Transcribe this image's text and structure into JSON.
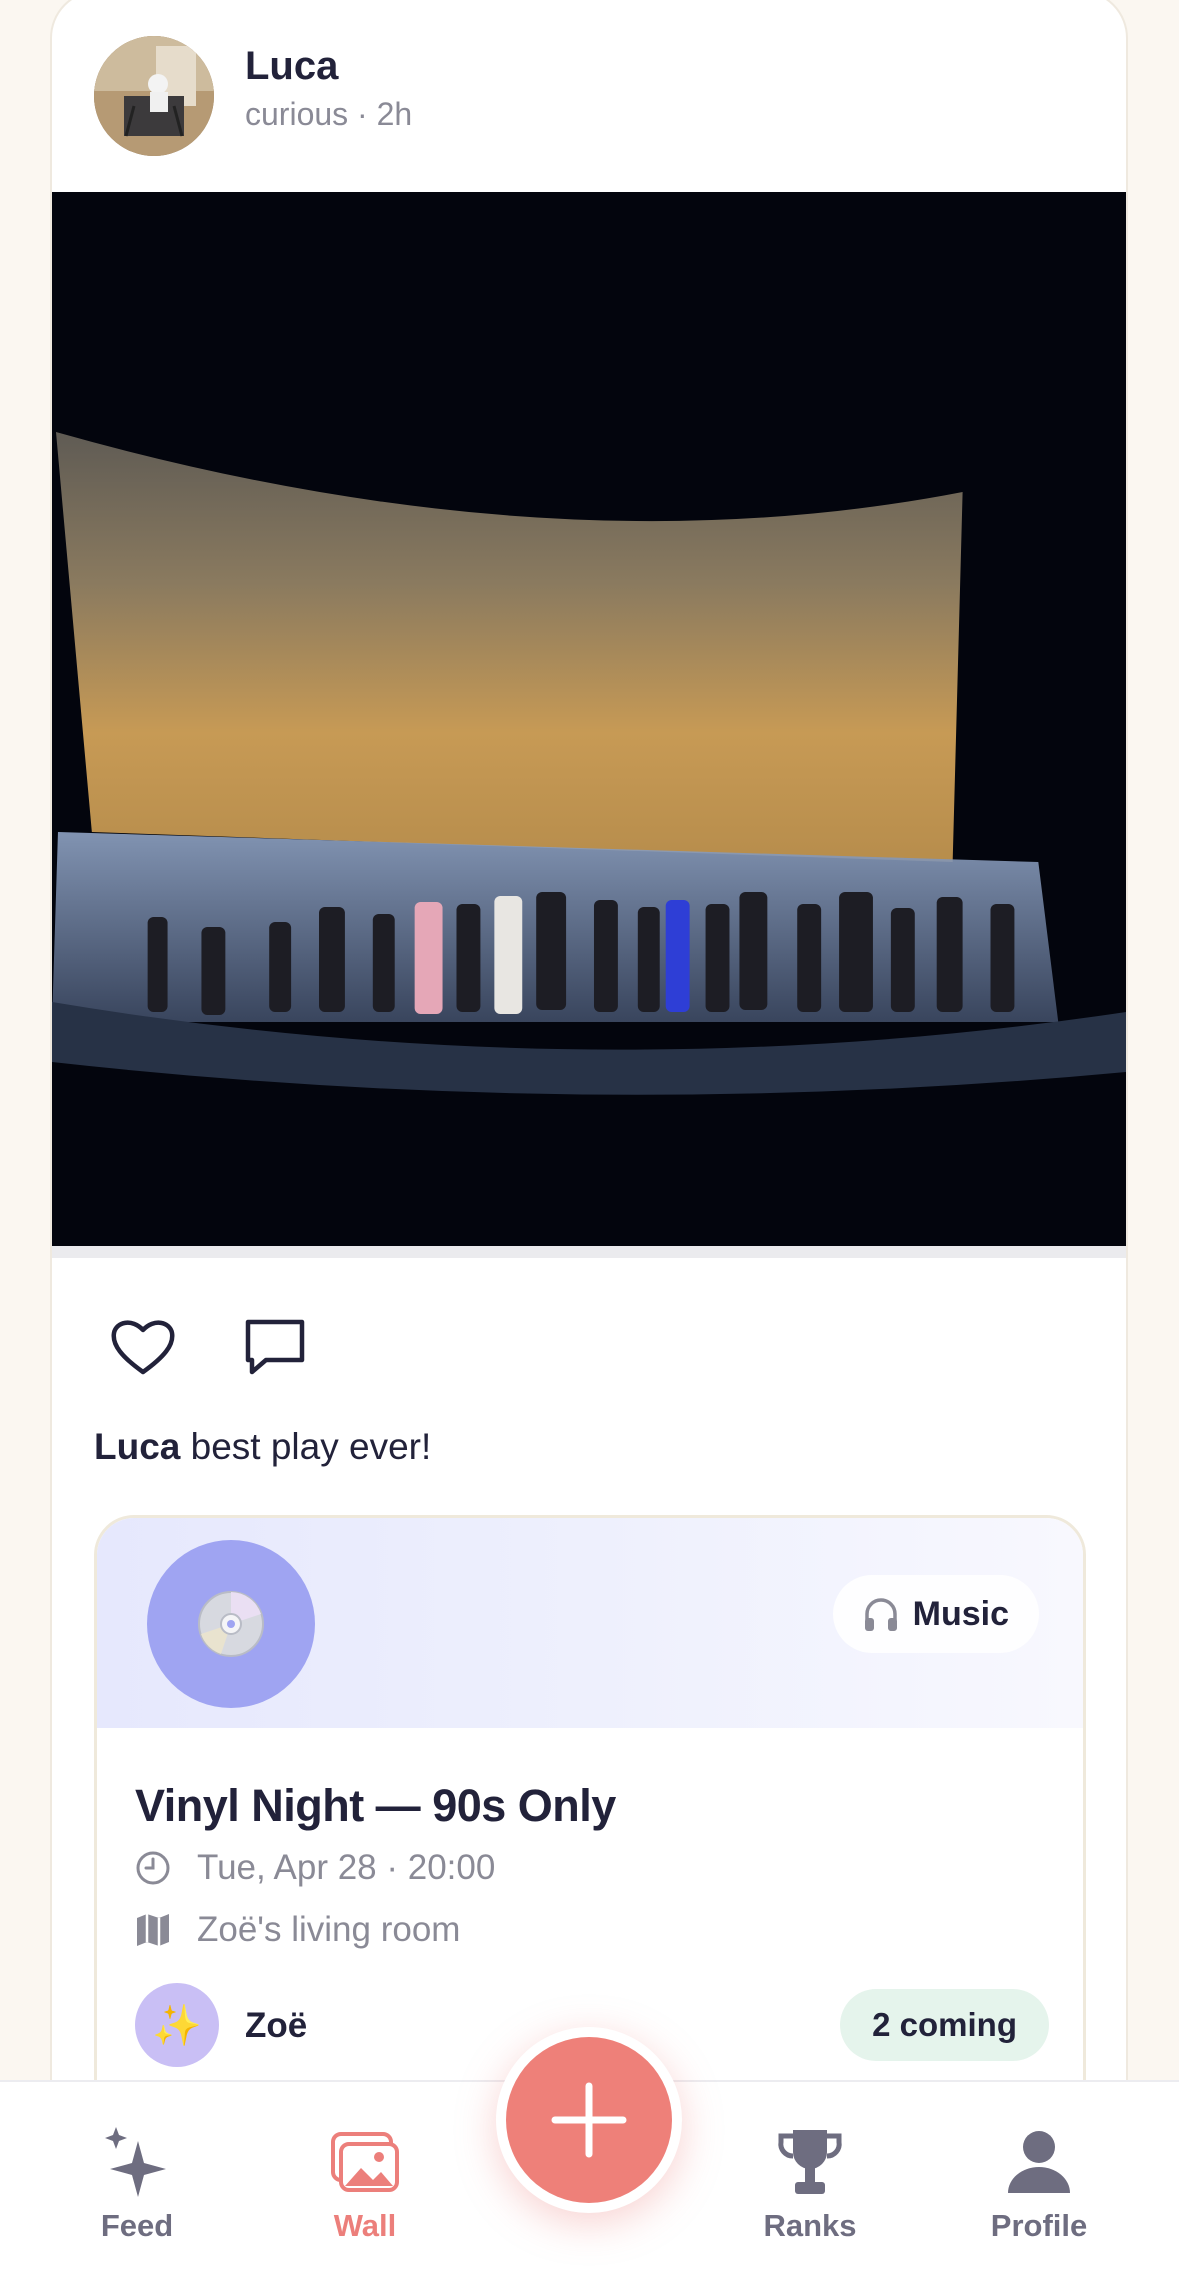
{
  "post": {
    "author": "Luca",
    "meta": "curious · 2h",
    "caption_author": "Luca",
    "caption_text": " best play ever!"
  },
  "event": {
    "category_icon": "headphones-icon",
    "category": "Music",
    "disc_icon": "cd-icon",
    "title": "Vinyl Night — 90s Only",
    "time": "Tue, Apr 28 · 20:00",
    "place": "Zoë's living room",
    "host_emoji": "✨",
    "host_name": "Zoë",
    "going": "2 coming"
  },
  "tabs": [
    {
      "label": "Feed",
      "icon": "sparkles-icon",
      "active": false
    },
    {
      "label": "Wall",
      "icon": "photos-icon",
      "active": true
    },
    {
      "label": "Ranks",
      "icon": "trophy-icon",
      "active": false
    },
    {
      "label": "Profile",
      "icon": "person-icon",
      "active": false
    }
  ],
  "colors": {
    "accent": "#ec7f7b",
    "background": "#fbf7f1",
    "text": "#22223a",
    "muted": "#8a8a96",
    "disc": "#9fa4f2",
    "going_bg": "#e5f4ec"
  }
}
